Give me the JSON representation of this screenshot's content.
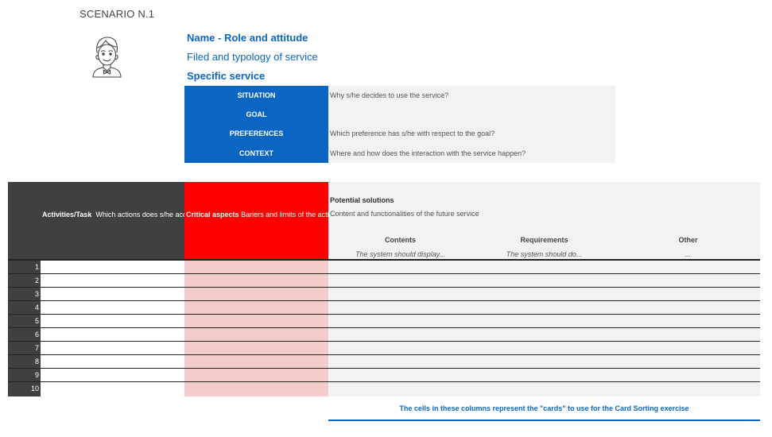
{
  "scenario_label": "SCENARIO N.1",
  "persona": {
    "icon": "person-avatar-icon",
    "name": "Name - Role and attitude",
    "field": "Filed and typology of service",
    "specific": "Specific service"
  },
  "info": [
    {
      "label": "SITUATION",
      "value": "Why s/he decides to use the service?"
    },
    {
      "label": "GOAL",
      "value": ""
    },
    {
      "label": "PREFERENCES",
      "value": "Which preference has s/he with respect to the goal?"
    },
    {
      "label": "CONTEXT",
      "value": "Where and how does the interaction with the service happen?"
    }
  ],
  "table": {
    "activities_title": "Activities/Task",
    "activities_desc": "Which actions does s/he accomplish?",
    "critical_title": "Critical aspects",
    "critical_desc": "Bariers and limits of the actions",
    "solutions_title": "Potential solutions",
    "solutions_desc": "Content and functionalities of the future service",
    "columns": [
      {
        "name": "Contents",
        "hint": "The system should display..."
      },
      {
        "name": "Requirements",
        "hint": "The system should do..."
      },
      {
        "name": "Other",
        "hint": "..."
      }
    ],
    "rows": [
      "1",
      "2",
      "3",
      "4",
      "5",
      "6",
      "7",
      "8",
      "9",
      "10"
    ]
  },
  "footer_note": "The cells in these columns represent the \"cards\" to use for the Card Sorting exercise",
  "colors": {
    "blue": "#0a66c2",
    "dark": "#404040",
    "red": "#ff0000",
    "pink": "#f4cccc",
    "gray": "#f2f2f2"
  }
}
